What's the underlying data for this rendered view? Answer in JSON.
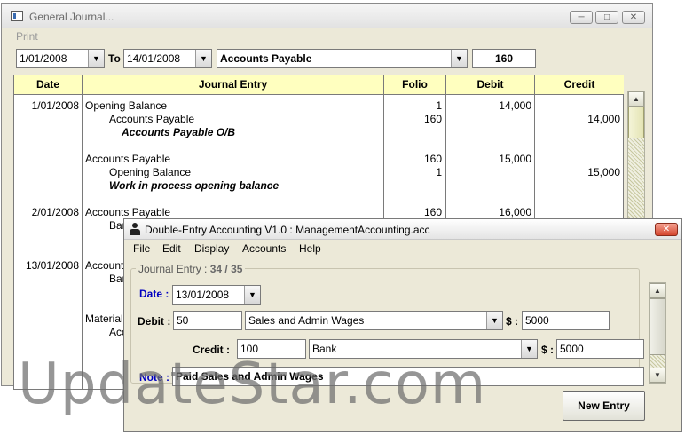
{
  "journal_window": {
    "title": "General Journal...",
    "menu": [
      "Print"
    ],
    "filter": {
      "from_date": "1/01/2008",
      "to_label": "To",
      "to_date": "14/01/2008",
      "account": "Accounts Payable",
      "account_code": "160"
    },
    "columns": [
      "Date",
      "Journal Entry",
      "Folio",
      "Debit",
      "Credit"
    ],
    "rows": [
      {
        "date": "1/01/2008",
        "entry": "Opening Balance",
        "indent": 0,
        "folio": "1",
        "debit": "14,000",
        "credit": ""
      },
      {
        "date": "",
        "entry": "Accounts Payable",
        "indent": 1,
        "folio": "160",
        "debit": "",
        "credit": "14,000"
      },
      {
        "date": "",
        "entry": "Accounts Payable O/B",
        "indent": 2,
        "folio": "",
        "debit": "",
        "credit": "",
        "note": true
      },
      {
        "date": "",
        "entry": "",
        "indent": 0,
        "folio": "",
        "debit": "",
        "credit": ""
      },
      {
        "date": "",
        "entry": "Accounts Payable",
        "indent": 0,
        "folio": "160",
        "debit": "15,000",
        "credit": ""
      },
      {
        "date": "",
        "entry": "Opening Balance",
        "indent": 1,
        "folio": "1",
        "debit": "",
        "credit": "15,000"
      },
      {
        "date": "",
        "entry": "Work in process opening balance",
        "indent": 1,
        "folio": "",
        "debit": "",
        "credit": "",
        "note": true
      },
      {
        "date": "",
        "entry": "",
        "indent": 0,
        "folio": "",
        "debit": "",
        "credit": ""
      },
      {
        "date": "2/01/2008",
        "entry": "Accounts Payable",
        "indent": 0,
        "folio": "160",
        "debit": "16,000",
        "credit": ""
      },
      {
        "date": "",
        "entry": "Ban",
        "indent": 1,
        "folio": "",
        "debit": "",
        "credit": ""
      },
      {
        "date": "",
        "entry": "",
        "indent": 1,
        "folio": "",
        "debit": "",
        "credit": ""
      },
      {
        "date": "",
        "entry": "",
        "indent": 0,
        "folio": "",
        "debit": "",
        "credit": ""
      },
      {
        "date": "13/01/2008",
        "entry": "Accounts",
        "indent": 0,
        "folio": "",
        "debit": "",
        "credit": ""
      },
      {
        "date": "",
        "entry": "Ban",
        "indent": 1,
        "folio": "",
        "debit": "",
        "credit": ""
      },
      {
        "date": "",
        "entry": "",
        "indent": 0,
        "folio": "",
        "debit": "",
        "credit": ""
      },
      {
        "date": "",
        "entry": "",
        "indent": 0,
        "folio": "",
        "debit": "",
        "credit": ""
      },
      {
        "date": "",
        "entry": "Material",
        "indent": 0,
        "folio": "",
        "debit": "",
        "credit": ""
      },
      {
        "date": "",
        "entry": "Acc",
        "indent": 1,
        "folio": "",
        "debit": "",
        "credit": ""
      },
      {
        "date": "",
        "entry": "",
        "indent": 1,
        "folio": "",
        "debit": "",
        "credit": ""
      }
    ]
  },
  "entry_window": {
    "title": "Double-Entry Accounting V1.0 : ManagementAccounting.acc",
    "menu": [
      "File",
      "Edit",
      "Display",
      "Accounts",
      "Help"
    ],
    "group": {
      "label": "Journal Entry :",
      "current": "34",
      "separator": "/",
      "total": "35"
    },
    "date_label": "Date :",
    "date_value": "13/01/2008",
    "debit_label": "Debit :",
    "debit_code": "50",
    "debit_account": "Sales and Admin Wages",
    "debit_currency_label": "$ :",
    "debit_amount": "5000",
    "credit_label": "Credit :",
    "credit_code": "100",
    "credit_account": "Bank",
    "credit_currency_label": "$ :",
    "credit_amount": "5000",
    "note_label": "Note :",
    "note_value": "Paid Sales and Admin Wages",
    "new_entry_label": "New Entry"
  },
  "watermark": "UpdateStar.com",
  "colors": {
    "header_bg": "#ffffbf",
    "window_bg": "#ece9d8",
    "label_blue": "#0000c0"
  }
}
